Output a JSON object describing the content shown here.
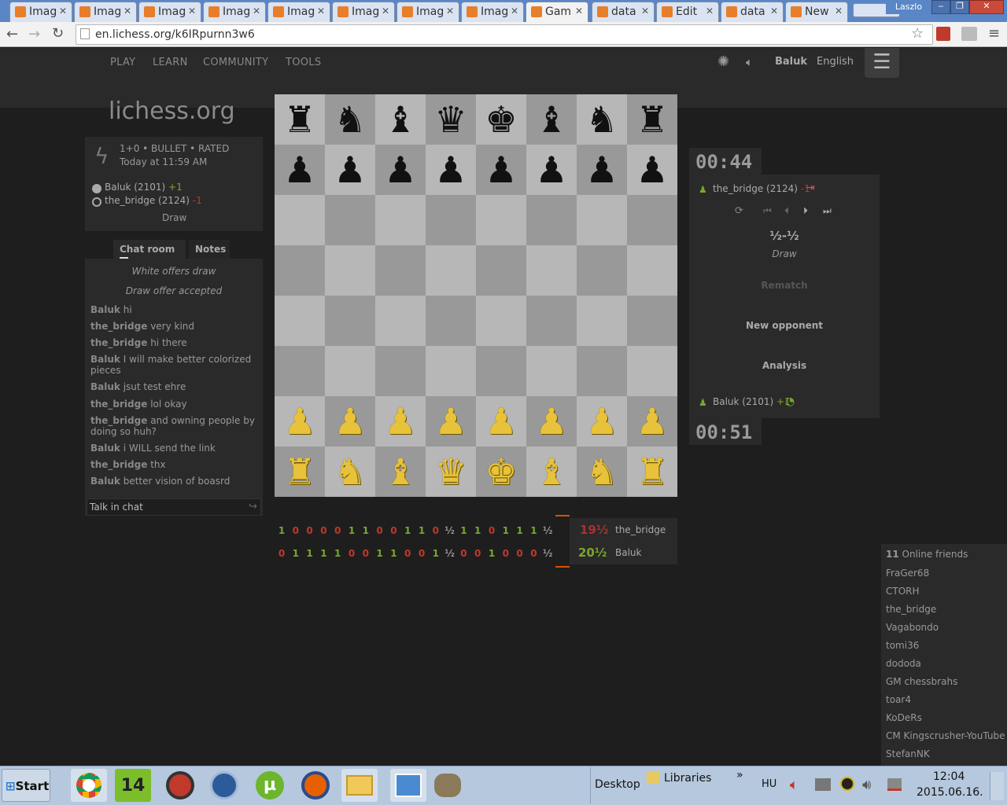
{
  "browser": {
    "tabs": [
      {
        "label": "Imag",
        "active": false
      },
      {
        "label": "Imag",
        "active": false
      },
      {
        "label": "Imag",
        "active": false
      },
      {
        "label": "Imag",
        "active": false
      },
      {
        "label": "Imag",
        "active": false
      },
      {
        "label": "Imag",
        "active": false
      },
      {
        "label": "Imag",
        "active": false
      },
      {
        "label": "Imag",
        "active": false
      },
      {
        "label": "Gam",
        "active": true
      },
      {
        "label": "data",
        "active": false
      },
      {
        "label": "Edit",
        "active": false
      },
      {
        "label": "data",
        "active": false
      },
      {
        "label": "New",
        "active": false
      }
    ],
    "profile_name": "Laszlo",
    "url": "en.lichess.org/k6IRpurnn3w6"
  },
  "nav": {
    "items": [
      "PLAY",
      "LEARN",
      "COMMUNITY",
      "TOOLS"
    ],
    "username": "Baluk",
    "language": "English"
  },
  "logo": "lichess.org",
  "game_info": {
    "mode": "1+0 • BULLET • RATED",
    "time": "Today at 11:59 AM",
    "white_player": "Baluk (2101)",
    "white_diff": "+1",
    "black_player": "the_bridge (2124)",
    "black_diff": "-1",
    "result": "Draw"
  },
  "chat": {
    "tab_chat": "Chat room",
    "tab_notes": "Notes",
    "system": [
      "White offers draw",
      "Draw offer accepted"
    ],
    "messages": [
      {
        "user": "Baluk",
        "text": "hi"
      },
      {
        "user": "the_bridge",
        "text": "very kind"
      },
      {
        "user": "the_bridge",
        "text": "hi there"
      },
      {
        "user": "Baluk",
        "text": "I will make better colorized pieces"
      },
      {
        "user": "Baluk",
        "text": "jsut test ehre"
      },
      {
        "user": "the_bridge",
        "text": "lol okay"
      },
      {
        "user": "the_bridge",
        "text": "and owning people by doing so huh?"
      },
      {
        "user": "Baluk",
        "text": "i WILL send the link"
      },
      {
        "user": "the_bridge",
        "text": "thx"
      },
      {
        "user": "Baluk",
        "text": "better vision of boasrd"
      }
    ],
    "input_placeholder": "Talk in chat"
  },
  "board": {
    "ranks": [
      [
        "♜",
        "♞",
        "♝",
        "♛",
        "♚",
        "♝",
        "♞",
        "♜"
      ],
      [
        "♟",
        "♟",
        "♟",
        "♟",
        "♟",
        "♟",
        "♟",
        "♟"
      ],
      [
        "",
        "",
        "",
        "",
        "",
        "",
        "",
        ""
      ],
      [
        "",
        "",
        "",
        "",
        "",
        "",
        "",
        ""
      ],
      [
        "",
        "",
        "",
        "",
        "",
        "",
        "",
        ""
      ],
      [
        "",
        "",
        "",
        "",
        "",
        "",
        "",
        ""
      ],
      [
        "♟",
        "♟",
        "♟",
        "♟",
        "♟",
        "♟",
        "♟",
        "♟"
      ],
      [
        "♜",
        "♞",
        "♝",
        "♛",
        "♚",
        "♝",
        "♞",
        "♜"
      ]
    ]
  },
  "right_panel": {
    "top_clock": "00:44",
    "top_player": "the_bridge (2124)",
    "top_diff": "-1",
    "score": "½-½",
    "status": "Draw",
    "rematch": "Rematch",
    "new_opponent": "New opponent",
    "analysis": "Analysis",
    "bottom_player": "Baluk (2101)",
    "bottom_diff": "+1",
    "bottom_clock": "00:51"
  },
  "crosstable": {
    "row1": [
      "1",
      "0",
      "0",
      "0",
      "0",
      "1",
      "1",
      "0",
      "0",
      "1",
      "1",
      "0",
      "½",
      "1",
      "1",
      "0",
      "1",
      "1",
      "1",
      "½"
    ],
    "row2": [
      "0",
      "1",
      "1",
      "1",
      "1",
      "0",
      "0",
      "1",
      "1",
      "0",
      "0",
      "1",
      "½",
      "0",
      "0",
      "1",
      "0",
      "0",
      "0",
      "½"
    ],
    "p1_score": "19½",
    "p1_name": "the_bridge",
    "p2_score": "20½",
    "p2_name": "Baluk"
  },
  "friends": {
    "count": "11",
    "title": "Online friends",
    "list": [
      "FraGer68",
      "CTORH",
      "the_bridge",
      "Vagabondo",
      "tomi36",
      "dododa",
      "GM chessbrahs",
      "toar4",
      "KoDeRs",
      "CM Kingscrusher-YouTube",
      "StefanNK"
    ]
  },
  "taskbar": {
    "start": "Start",
    "badge": "14",
    "desktop": "Desktop",
    "libraries": "Libraries",
    "lang": "HU",
    "time": "12:04",
    "date": "2015.06.16."
  }
}
